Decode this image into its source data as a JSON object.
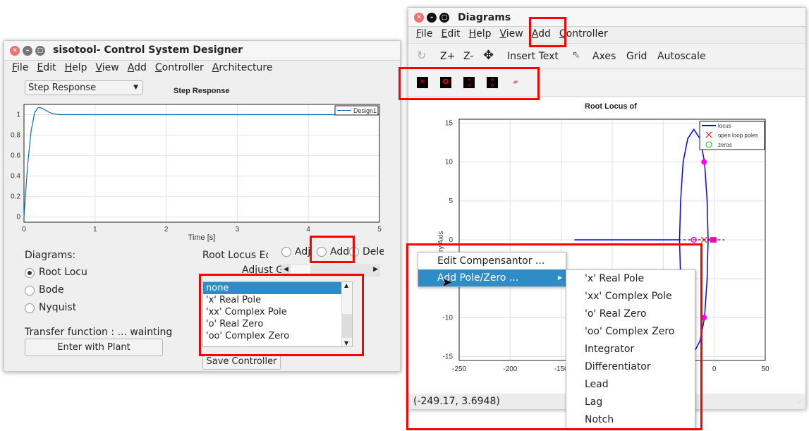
{
  "left_window": {
    "title": "sisotool- Control System Designer",
    "menu": [
      "File",
      "Edit",
      "Help",
      "View",
      "Add",
      "Controller",
      "Architecture"
    ],
    "plot_select": "Step Response",
    "diagrams_label": "Diagrams:",
    "diagram_options": [
      {
        "label": "Root Locu",
        "selected": true
      },
      {
        "label": "Bode",
        "selected": false
      },
      {
        "label": "Nyquist",
        "selected": false
      }
    ],
    "root_locus_label": "Root Locus Ed",
    "mode_options": [
      {
        "label": "Adj",
        "selected": false
      },
      {
        "label": "Add",
        "selected": false
      },
      {
        "label": "Dele",
        "selected": false
      }
    ],
    "adjust_label": "Adjust G",
    "listbox_items": [
      "none",
      "'x' Real Pole",
      "'xx' Complex Pole",
      "'o' Real Zero",
      "'oo' Complex Zero"
    ],
    "listbox_selected": "none",
    "transfer_label": "Transfer function : ... wainting",
    "enter_plant_button": "Enter with Plant",
    "save_controller_button": "Save Controller"
  },
  "right_window": {
    "title": "Diagrams",
    "menu": [
      "File",
      "Edit",
      "Help",
      "View",
      "Add",
      "Controller"
    ],
    "toolbar": [
      "Z+",
      "Z-",
      "Insert Text",
      "Axes",
      "Grid",
      "Autoscale"
    ],
    "toolbar_icons": [
      "rotate-icon",
      "zoom-in",
      "zoom-out",
      "pan-icon",
      "insert-text",
      "pointer-icon"
    ],
    "pz_icons": [
      "real-pole-icon",
      "real-zero-icon",
      "complex-pole-icon",
      "complex-zero-icon",
      "eraser-icon"
    ],
    "status": "(-249.17, 3.6948)",
    "context_menu": {
      "items": [
        "Edit Compensantor ...",
        "Add Pole/Zero ..."
      ],
      "highlighted": "Add Pole/Zero ..."
    },
    "submenu": [
      "'x' Real Pole",
      "'xx' Complex Pole",
      "'o' Real Zero",
      "'oo' Complex Zero",
      "Integrator",
      "Differentiator",
      "Lead",
      "Lag",
      "Notch"
    ]
  },
  "colors": {
    "highlight": "#308cc6",
    "annotation": "#ff0000",
    "locus": "#0000ff",
    "step": "#0072bd",
    "marker": "#ff00ff"
  },
  "chart_data": [
    {
      "type": "line",
      "title": "Step Response",
      "xlabel": "Time [s]",
      "xlim": [
        0,
        5
      ],
      "ylim": [
        -0.05,
        1.1
      ],
      "xticks": [
        "0",
        "1",
        "2",
        "3",
        "4",
        "5"
      ],
      "yticks": [
        "0",
        "0.2",
        "0.4",
        "0.6",
        "0.8",
        "1"
      ],
      "grid": true,
      "legend_position": "top-right",
      "series": [
        {
          "name": "Design1",
          "x": [
            0,
            0.02,
            0.05,
            0.1,
            0.15,
            0.2,
            0.25,
            0.3,
            0.35,
            0.4,
            0.5,
            1,
            2,
            3,
            4,
            5
          ],
          "y": [
            0,
            0.2,
            0.5,
            0.84,
            1.02,
            1.07,
            1.065,
            1.045,
            1.025,
            1.01,
            1.0,
            1.0,
            1.0,
            1.0,
            1.0,
            1.0
          ]
        }
      ]
    },
    {
      "type": "scatter",
      "title": "Root Locus of",
      "ylabel": "Imaginary Axis",
      "xlim": [
        -250,
        50
      ],
      "ylim": [
        -15.5,
        15.5
      ],
      "xticks": [
        "-250",
        "-200",
        "-150",
        "-100",
        "-50",
        "0",
        "50"
      ],
      "yticks": [
        "-15",
        "-10",
        "-5",
        "0",
        "5",
        "10",
        "15"
      ],
      "grid": true,
      "legend_position": "top-right",
      "legend": [
        "locus",
        "open loop poles",
        "zeros"
      ],
      "locus_branches": [
        [
          [
            -137,
            0
          ],
          [
            -34,
            0
          ]
        ],
        [
          [
            -34,
            0
          ],
          [
            -33,
            -5
          ],
          [
            -30.5,
            -10
          ],
          [
            -26,
            -13
          ],
          [
            -20,
            -14.5
          ],
          [
            -14,
            -13
          ],
          [
            -9.5,
            -10
          ],
          [
            -7,
            -5
          ],
          [
            -6,
            0
          ],
          [
            -7,
            5
          ],
          [
            -9.5,
            10
          ],
          [
            -14,
            13
          ],
          [
            -20,
            14.2
          ],
          [
            -26,
            13
          ],
          [
            -30.5,
            10
          ],
          [
            -33,
            5
          ],
          [
            -34,
            0
          ]
        ],
        [
          [
            -6,
            0
          ],
          [
            0,
            0
          ]
        ]
      ],
      "open_loop_poles": [
        [
          -10,
          0
        ],
        [
          -1,
          0
        ]
      ],
      "zeros": [
        [
          -20,
          0
        ]
      ],
      "closed_loop_poles": [
        [
          -10,
          10
        ],
        [
          -10,
          -10
        ],
        [
          -2,
          0
        ],
        [
          0,
          0
        ]
      ]
    }
  ]
}
